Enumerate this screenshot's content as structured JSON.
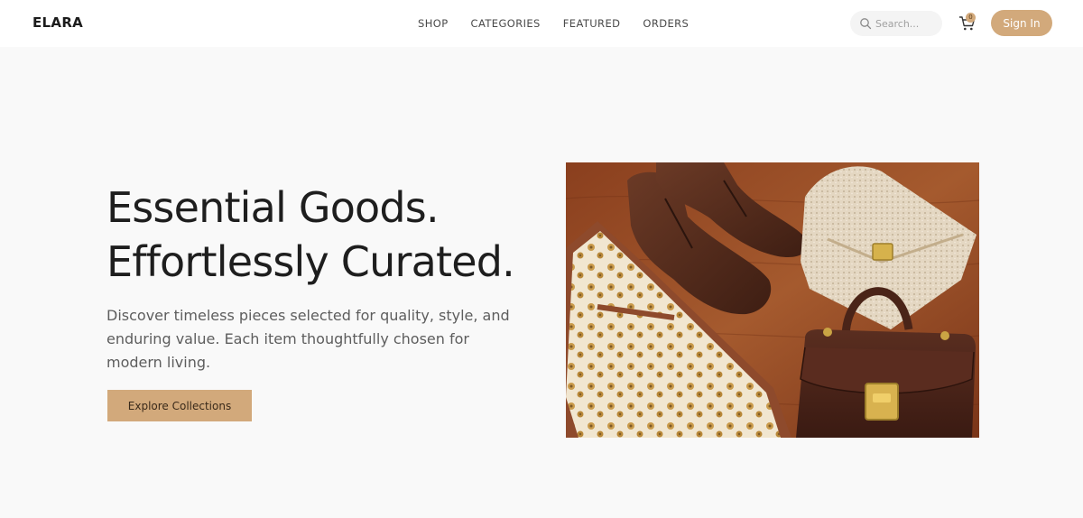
{
  "header": {
    "logo": "ELARA",
    "nav": [
      "SHOP",
      "CATEGORIES",
      "FEATURED",
      "ORDERS"
    ],
    "search": {
      "placeholder": "Search..."
    },
    "cart": {
      "count": "0"
    },
    "signin_label": "Sign In"
  },
  "hero": {
    "title_line1": "Essential Goods.",
    "title_line2": "Effortlessly Curated.",
    "description": "Discover timeless pieces selected for quality, style, and enduring value. Each item thoughtfully chosen for modern living.",
    "cta_label": "Explore Collections",
    "image_alt": "Leather boots, patterned silk scarf, tweed clutch and brown leather handbag on a wooden table"
  },
  "colors": {
    "accent": "#d2a97b",
    "background": "#f9f9f9",
    "header_bg": "#ffffff",
    "text_dark": "#1e1e1e",
    "text_muted": "#5d5d5d"
  },
  "icons": {
    "search": "search-icon",
    "cart": "cart-icon"
  }
}
